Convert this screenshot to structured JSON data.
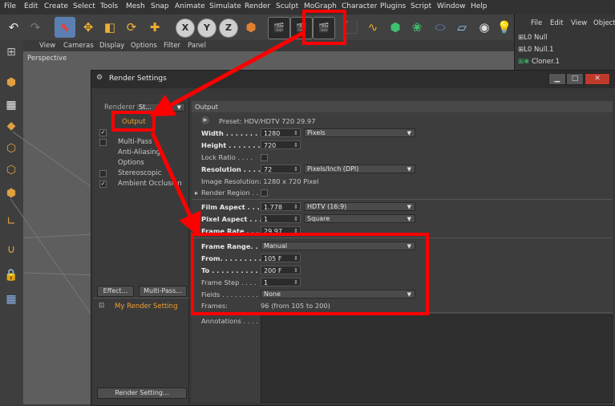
{
  "menubar": {
    "items": [
      "File",
      "Edit",
      "Create",
      "Select",
      "Tools",
      "Mesh",
      "Snap",
      "Animate",
      "Simulate",
      "Render",
      "Sculpt",
      "MoGraph",
      "Character",
      "Plugins",
      "Script",
      "Window",
      "Help"
    ]
  },
  "viewport": {
    "menu": [
      "View",
      "Cameras",
      "Display",
      "Options",
      "Filter",
      "Panel"
    ],
    "label": "Perspective"
  },
  "toolbar": {
    "axis_x": "X",
    "axis_y": "Y",
    "axis_z": "Z"
  },
  "object_manager": {
    "menu": [
      "File",
      "Edit",
      "View",
      "Object"
    ],
    "objects": [
      "Null",
      "Null.1",
      "Cloner.1"
    ]
  },
  "render_settings": {
    "title": "Render Settings",
    "renderer_label": "Renderer",
    "renderer_value": "St...",
    "categories": [
      "Output",
      "Multi-Pass",
      "Anti-Aliasing",
      "Options",
      "Stereoscopic",
      "Ambient Occlusion"
    ],
    "effect_button": "Effect...",
    "multipass_button": "Multi-Pass...",
    "preset_name": "My Render Setting",
    "render_setting_button": "Render Setting...",
    "section_title": "Output",
    "preset_line": "Preset: HDV/HDTV 720 29.97",
    "width_label": "Width . . . . . . . .",
    "width_value": "1280",
    "width_unit": "Pixels",
    "height_label": "Height . . . . . . . .",
    "height_value": "720",
    "lock_ratio_label": "Lock Ratio . . . .",
    "resolution_label": "Resolution . . . . .",
    "resolution_value": "72",
    "resolution_unit": "Pixels/Inch (DPI)",
    "image_resolution": "Image Resolution: 1280 x 720 Pixel",
    "render_region_label": "Render Region . .",
    "film_aspect_label": "Film Aspect . . . .",
    "film_aspect_value": "1.778",
    "film_aspect_preset": "HDTV (16:9)",
    "pixel_aspect_label": "Pixel Aspect . . . .",
    "pixel_aspect_value": "1",
    "pixel_aspect_preset": "Square",
    "frame_rate_label": "Frame Rate . . . . .",
    "frame_rate_value": "29.97",
    "frame_range_label": "Frame Range. . . .",
    "frame_range_value": "Manual",
    "from_label": "From. . . . . . . . . . .",
    "from_value": "105 F",
    "to_label": "To . . . . . . . . . . . .",
    "to_value": "200 F",
    "frame_step_label": "Frame Step . . . .",
    "frame_step_value": "1",
    "fields_label": "Fields . . . . . . . . .",
    "fields_value": "None",
    "frames_line": "Frames:",
    "frames_value": "96 (from 105 to 200)",
    "annotations_label": "Annotations . . . . ."
  },
  "colors": {
    "annotation_red": "#ff0000",
    "accent_orange": "#f0a030"
  }
}
